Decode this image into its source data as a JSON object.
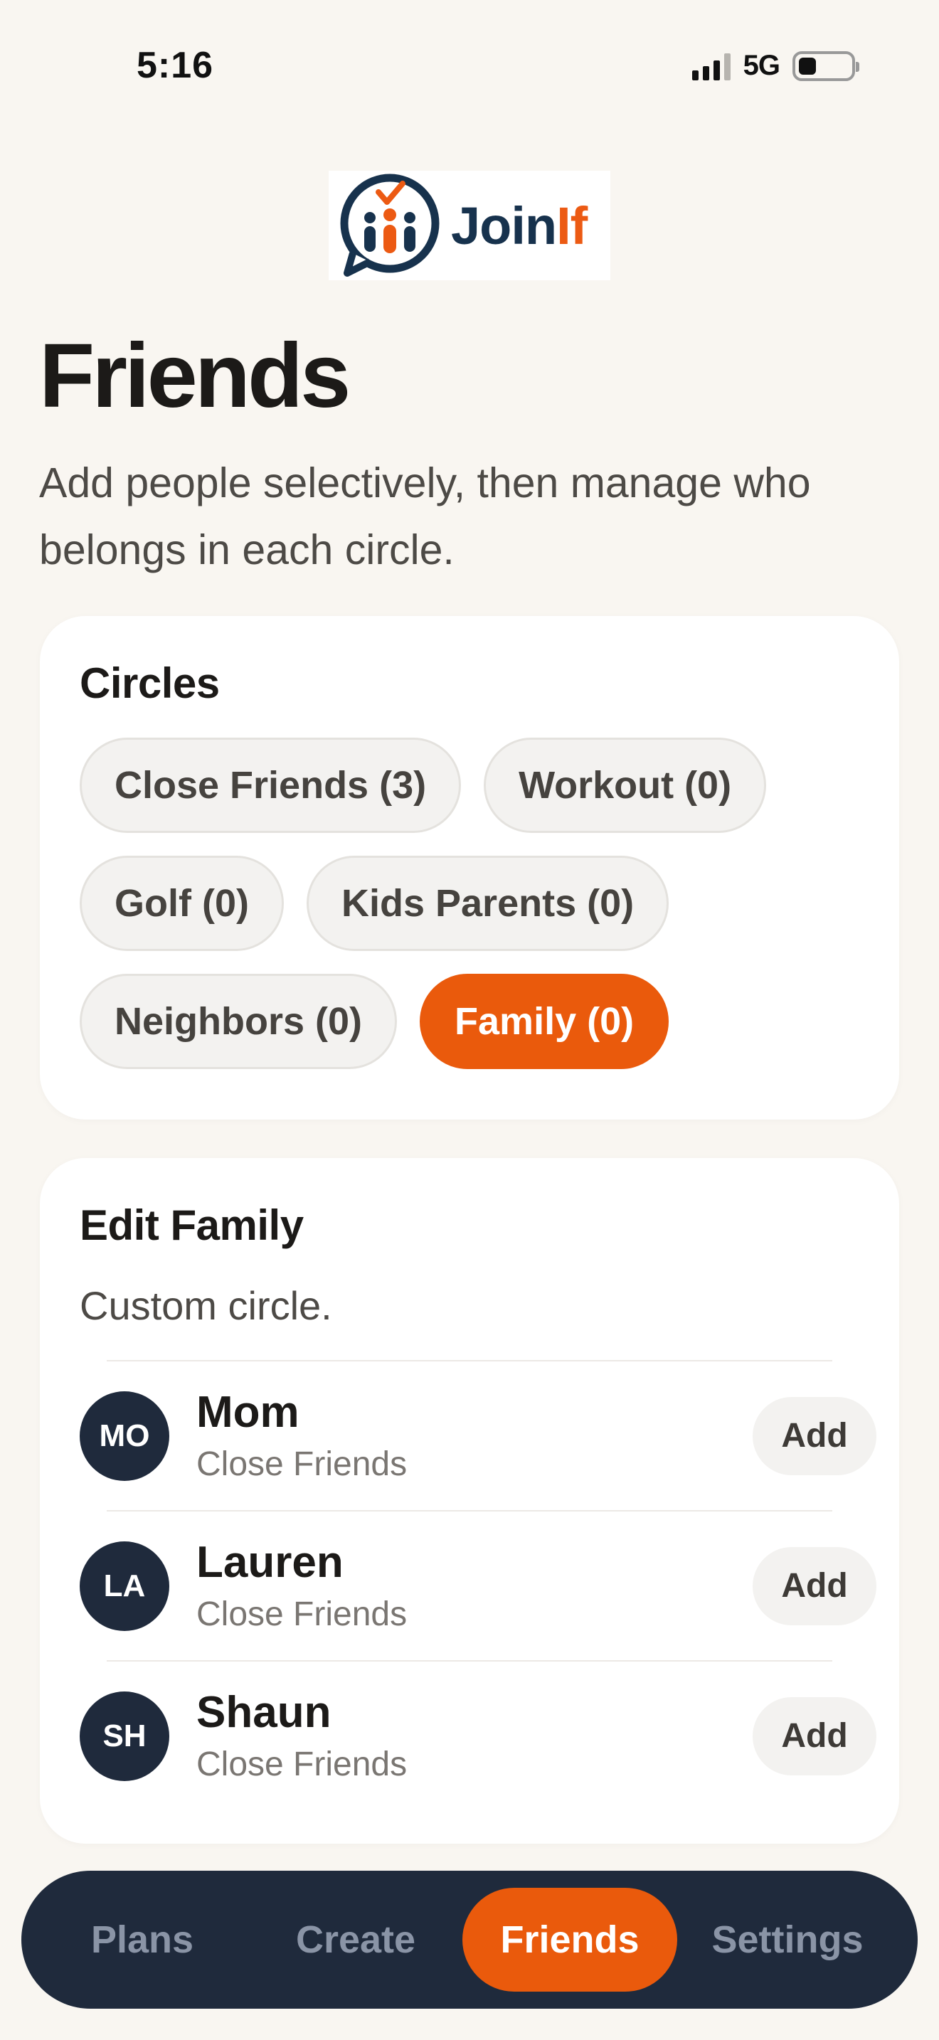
{
  "status": {
    "time": "5:16",
    "network": "5G"
  },
  "logo": {
    "word_join": "Join",
    "word_if": "If"
  },
  "header": {
    "title": "Friends",
    "subtitle": "Add people selectively, then manage who belongs in each circle."
  },
  "circles": {
    "title": "Circles",
    "chips": [
      {
        "label": "Close Friends (3)",
        "active": false
      },
      {
        "label": "Workout (0)",
        "active": false
      },
      {
        "label": "Golf (0)",
        "active": false
      },
      {
        "label": "Kids Parents (0)",
        "active": false
      },
      {
        "label": "Neighbors (0)",
        "active": false
      },
      {
        "label": "Family (0)",
        "active": true
      }
    ]
  },
  "edit": {
    "title": "Edit Family",
    "subtitle": "Custom circle.",
    "members": [
      {
        "initials": "MO",
        "name": "Mom",
        "circle": "Close Friends",
        "action": "Add"
      },
      {
        "initials": "LA",
        "name": "Lauren",
        "circle": "Close Friends",
        "action": "Add"
      },
      {
        "initials": "SH",
        "name": "Shaun",
        "circle": "Close Friends",
        "action": "Add"
      }
    ]
  },
  "tabbar": {
    "plans": "Plans",
    "create": "Create",
    "friends": "Friends",
    "settings": "Settings",
    "active": "friends"
  },
  "colors": {
    "accent": "#ea5a0c",
    "navy": "#1f2a3c",
    "background": "#f9f6f1"
  }
}
